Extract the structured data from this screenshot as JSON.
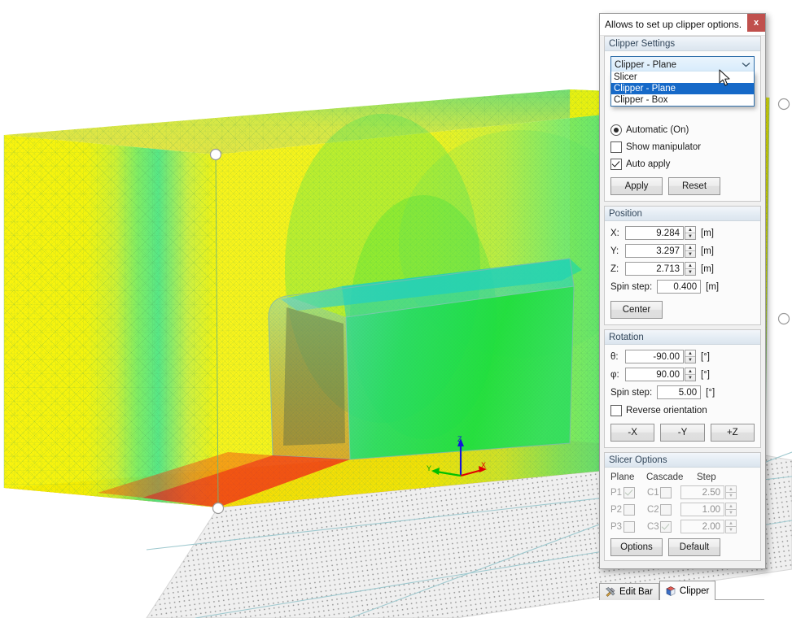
{
  "window": {
    "title": "Allows to set up clipper options.",
    "close_label": "x",
    "close_icon": "close-icon"
  },
  "clipper_settings": {
    "group_title": "Clipper Settings",
    "mode_combo": {
      "value": "Clipper - Plane",
      "expanded": true,
      "arrow_icon": "chevron-down-icon",
      "options": [
        {
          "label": "Slicer",
          "selected": false
        },
        {
          "label": "Clipper - Plane",
          "selected": true
        },
        {
          "label": "Clipper - Box",
          "selected": false
        }
      ]
    },
    "automatic_radio": {
      "label": "Automatic (On)",
      "checked": true
    },
    "show_manipulator": {
      "label": "Show manipulator",
      "checked": false
    },
    "auto_apply": {
      "label": "Auto apply",
      "checked": true
    },
    "apply_button": "Apply",
    "reset_button": "Reset"
  },
  "position": {
    "group_title": "Position",
    "x": {
      "label": "X:",
      "value": "9.284",
      "unit": "[m]"
    },
    "y": {
      "label": "Y:",
      "value": "3.297",
      "unit": "[m]"
    },
    "z": {
      "label": "Z:",
      "value": "2.713",
      "unit": "[m]"
    },
    "spin_step": {
      "label": "Spin step:",
      "value": "0.400",
      "unit": "[m]"
    },
    "center_button": "Center"
  },
  "rotation": {
    "group_title": "Rotation",
    "theta": {
      "label": "θ:",
      "value": "-90.00",
      "unit": "[°]"
    },
    "phi": {
      "label": "φ:",
      "value": "90.00",
      "unit": "[°]"
    },
    "spin_step": {
      "label": "Spin step:",
      "value": "5.00",
      "unit": "[°]"
    },
    "reverse_orientation": {
      "label": "Reverse orientation",
      "checked": false
    },
    "axis_buttons": [
      "-X",
      "-Y",
      "+Z"
    ]
  },
  "slicer_options": {
    "group_title": "Slicer Options",
    "enabled": false,
    "headers": [
      "Plane",
      "Cascade",
      "Step"
    ],
    "rows": [
      {
        "plane_label": "P1",
        "plane_checked": true,
        "cascade_label": "C1",
        "cascade_checked": false,
        "step": "2.50"
      },
      {
        "plane_label": "P2",
        "plane_checked": false,
        "cascade_label": "C2",
        "cascade_checked": false,
        "step": "1.00"
      },
      {
        "plane_label": "P3",
        "plane_checked": false,
        "cascade_label": "C3",
        "cascade_checked": true,
        "step": "2.00"
      }
    ],
    "options_button": "Options",
    "default_button": "Default"
  },
  "tabs": [
    {
      "label": "Edit Bar",
      "icon": "tools-icon",
      "active": false
    },
    {
      "label": "Clipper",
      "icon": "cube-icon",
      "active": true
    }
  ],
  "viewport": {
    "axis_triad": {
      "x_label": "X",
      "y_label": "Y",
      "z_label": "Z"
    },
    "colors": {
      "mesh_yellow": "#fcf806",
      "mesh_green": "#17e034",
      "mesh_orange": "#f7a71a",
      "mesh_red": "#f51010",
      "mesh_teal": "#14c8b4",
      "wire": "#57a05f",
      "ground": "#efefef",
      "axis_x": "#ee0000",
      "axis_y": "#00c000",
      "axis_z": "#0000dd",
      "handle": "#ffffff"
    }
  }
}
